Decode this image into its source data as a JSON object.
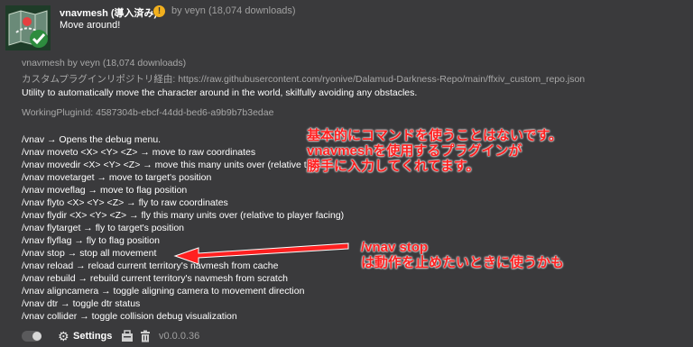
{
  "header": {
    "name": "vnavmesh (導入済み)",
    "meta": "by veyn (18,074 downloads)",
    "description": "Move around!",
    "warning_symbol": "!"
  },
  "detail": {
    "title_line": "vnavmesh by veyn (18,074 downloads)",
    "repo_line": "カスタムプラグインリポジトリ経由: https://raw.githubusercontent.com/ryonive/Dalamud-Darkness-Repo/main/ffxiv_custom_repo.json",
    "summary": "Utility to automatically move the character around in the world, skilfully avoiding any obstacles.",
    "working_id": "WorkingPluginId: 4587304b-ebcf-44dd-bed6-a9b9b7b3edae"
  },
  "commands": [
    "/vnav → Opens the debug menu.",
    "/vnav moveto <X> <Y> <Z> → move to raw coordinates",
    "/vnav movedir <X> <Y> <Z> → move this many units over (relative t",
    "/vnav movetarget → move to target's position",
    "/vnav moveflag → move to flag position",
    "/vnav flyto <X> <Y> <Z> → fly to raw coordinates",
    "/vnav flydir <X> <Y> <Z> → fly this many units over (relative to player facing)",
    "/vnav flytarget → fly to target's position",
    "/vnav flyflag → fly to flag position",
    "/vnav stop → stop all movement",
    "/vnav reload → reload current territory's navmesh from cache",
    "/vnav rebuild → rebuild current territory's navmesh from scratch",
    "/vnav aligncamera → toggle aligning camera to movement direction",
    "/vnav dtr → toggle dtr status",
    "/vnav collider → toggle collision debug visualization"
  ],
  "annotations": {
    "note1": [
      "基本的にコマンドを使うことはないです。",
      "vnavmeshを使用するプラグインが",
      "勝手に入力してくれてます。"
    ],
    "note2": [
      "/vnav stop",
      "は動作を止めたいときに使うかも"
    ],
    "color": "#ff2020"
  },
  "footer": {
    "settings_label": "Settings",
    "version": "v0.0.0.36",
    "toggle_on": false
  },
  "icons": [
    "plugin-map-icon",
    "warning-icon",
    "gear-icon",
    "copy-icon",
    "trash-icon",
    "checkmark-icon",
    "red-arrow-icon"
  ]
}
